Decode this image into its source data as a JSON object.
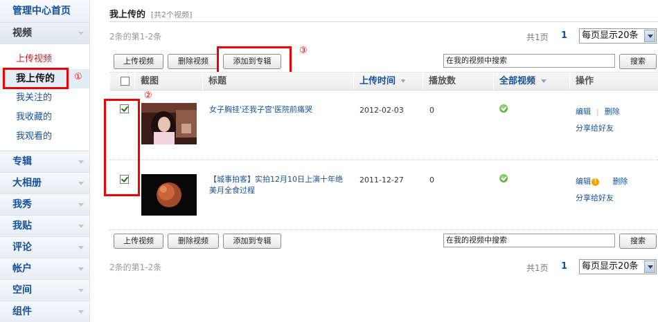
{
  "sidebar": {
    "home": "管理中心首页",
    "video_group": "视频",
    "video_items": [
      "上传视频",
      "我上传的",
      "我关注的",
      "我收藏的",
      "我观看的"
    ],
    "groups": [
      "专辑",
      "大相册",
      "我秀",
      "我贴",
      "评论",
      "帐户",
      "空间",
      "组件"
    ]
  },
  "page": {
    "title": "我上传的",
    "count": "[共2个视频]"
  },
  "pager": {
    "range": "2条的第1-2条",
    "pages": "共1页",
    "current": "1",
    "per_page": "每页显示20条"
  },
  "toolbar": {
    "upload": "上传视频",
    "delete": "删除视频",
    "add_album": "添加到专辑",
    "search_value": "在我的视频中搜索",
    "search_btn": "搜索"
  },
  "table": {
    "columns": [
      "截图",
      "标题",
      "上传时间",
      "播放数",
      "全部视频",
      "操作"
    ],
    "rows": [
      {
        "title": "女子胸挂'还我子宫'医院前痛哭",
        "date": "2012-02-03",
        "plays": "0",
        "checked": true,
        "actions": [
          "编辑",
          "删除",
          "分享给好友"
        ],
        "warning": false
      },
      {
        "title": "【城事拍客】实拍12月10日上演十年绝美月全食过程",
        "date": "2011-12-27",
        "plays": "0",
        "checked": true,
        "actions": [
          "编辑",
          "删除",
          "分享给好友"
        ],
        "warning": true
      }
    ]
  },
  "annotations": {
    "mark1": "①",
    "mark2": "②",
    "mark3": "③"
  },
  "colors": {
    "link": "#15519a",
    "highlight": "#e00000"
  }
}
